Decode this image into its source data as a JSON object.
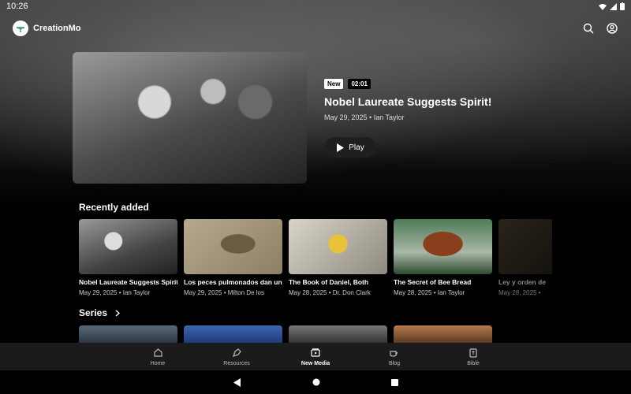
{
  "status": {
    "time": "10:26"
  },
  "app": {
    "name": "CreationMo"
  },
  "hero": {
    "badge_new": "New",
    "duration": "02:01",
    "title": "Nobel Laureate Suggests Spirit!",
    "meta": "May 29, 2025 • Ian Taylor",
    "play_label": "Play"
  },
  "recent": {
    "title": "Recently added",
    "items": [
      {
        "title": "Nobel Laureate Suggests Spirit!",
        "meta": "May 29, 2025 • Ian Taylor"
      },
      {
        "title": "Los peces pulmonados dan un",
        "meta": "May 29, 2025 • Milton De los"
      },
      {
        "title": "The Book of Daniel, Both",
        "meta": "May 28, 2025 • Dr. Don Clark"
      },
      {
        "title": "The Secret of Bee Bread",
        "meta": "May 28, 2025 • Ian Taylor"
      },
      {
        "title": "Ley y orden de",
        "meta": "May 28, 2025 •"
      }
    ]
  },
  "series": {
    "title": "Series"
  },
  "nav": {
    "items": [
      {
        "label": "Home",
        "icon": "home-icon"
      },
      {
        "label": "Resources",
        "icon": "pen-icon"
      },
      {
        "label": "New Media",
        "icon": "media-icon"
      },
      {
        "label": "Blog",
        "icon": "coffee-icon"
      },
      {
        "label": "Bible",
        "icon": "book-icon"
      }
    ],
    "active": "New Media"
  },
  "colors": {
    "accent": "#2e9e6b",
    "nav_bg": "#1b1b1b"
  }
}
